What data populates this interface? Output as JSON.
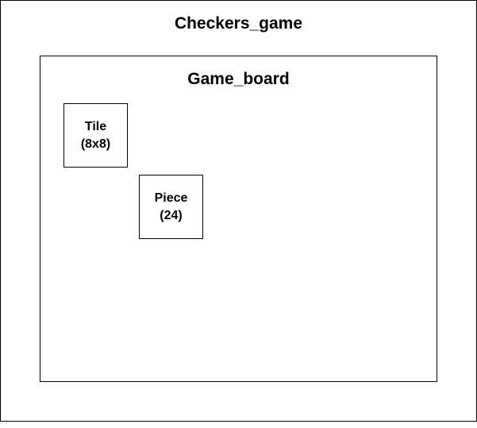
{
  "diagram": {
    "outer": {
      "label": "Checkers_game"
    },
    "inner": {
      "label": "Game_board"
    },
    "tile": {
      "name": "Tile",
      "count": "(8x8)"
    },
    "piece": {
      "name": "Piece",
      "count": "(24)"
    }
  }
}
